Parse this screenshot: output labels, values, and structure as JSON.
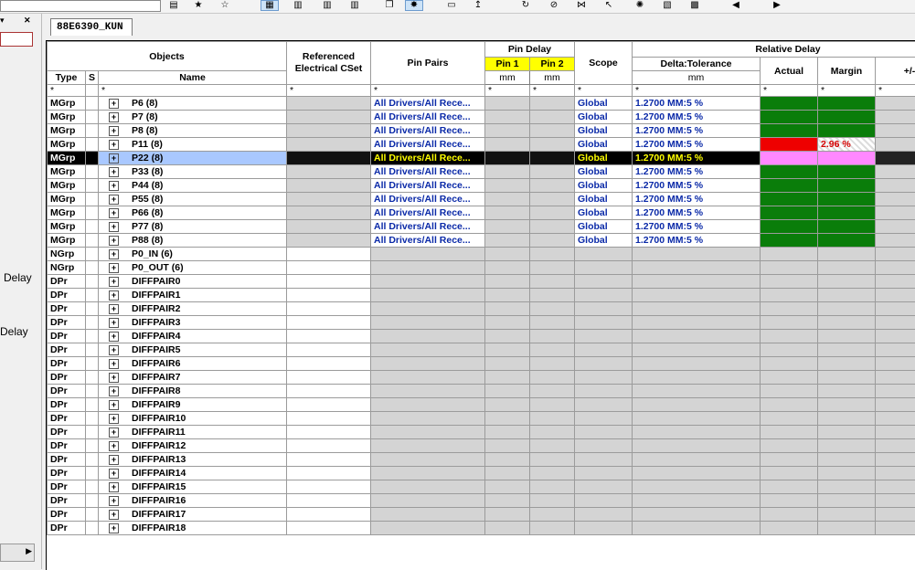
{
  "toolbar": {
    "icons": [
      "folder-icon",
      "star-icon",
      "star-icon",
      "grid-view-icon",
      "table-icon",
      "table-icon",
      "table-icon",
      "copy-icon",
      "burst-icon",
      "properties-icon",
      "pin-icon",
      "forward-icon",
      "cancel-icon",
      "bowtie-icon",
      "cursor-icon",
      "spark-icon",
      "chart-icon",
      "map-icon",
      "back-arrow-icon",
      "forward-arrow-icon"
    ]
  },
  "left_panel": {
    "label_delay_1": "Delay",
    "label_delay_2": "Delay"
  },
  "tab": {
    "label": "88E6390_KUN"
  },
  "grid": {
    "headers": {
      "objects": "Objects",
      "type": "Type",
      "s": "S",
      "name": "Name",
      "ref_cset": "Referenced Electrical CSet",
      "pin_pairs": "Pin Pairs",
      "pin_delay": "Pin Delay",
      "pin1": "Pin 1",
      "pin2": "Pin 2",
      "pin_unit": "mm",
      "scope": "Scope",
      "relative_delay": "Relative Delay",
      "delta_tol": "Delta:Tolerance",
      "delta_unit": "mm",
      "actual": "Actual",
      "margin": "Margin",
      "plusminus": "+/-"
    },
    "filter": "*",
    "rows": [
      {
        "type": "MGrp",
        "name": "P6 (8)",
        "pin_pairs": "All Drivers/All Rece...",
        "scope": "Global",
        "delta": "1.2700 MM:5 %",
        "actual": "green",
        "margin": "green",
        "margin_text": ""
      },
      {
        "type": "MGrp",
        "name": "P7 (8)",
        "pin_pairs": "All Drivers/All Rece...",
        "scope": "Global",
        "delta": "1.2700 MM:5 %",
        "actual": "green",
        "margin": "green",
        "margin_text": ""
      },
      {
        "type": "MGrp",
        "name": "P8 (8)",
        "pin_pairs": "All Drivers/All Rece...",
        "scope": "Global",
        "delta": "1.2700 MM:5 %",
        "actual": "green",
        "margin": "green",
        "margin_text": ""
      },
      {
        "type": "MGrp",
        "name": "P11 (8)",
        "pin_pairs": "All Drivers/All Rece...",
        "scope": "Global",
        "delta": "1.2700 MM:5 %",
        "actual": "red",
        "margin": "hatch",
        "margin_text": "2.96 %"
      },
      {
        "type": "MGrp",
        "name": "P22 (8)",
        "pin_pairs": "All Drivers/All Rece...",
        "scope": "Global",
        "delta": "1.2700 MM:5 %",
        "actual": "pink",
        "margin": "pink",
        "margin_text": "",
        "selected": true
      },
      {
        "type": "MGrp",
        "name": "P33 (8)",
        "pin_pairs": "All Drivers/All Rece...",
        "scope": "Global",
        "delta": "1.2700 MM:5 %",
        "actual": "green",
        "margin": "green",
        "margin_text": ""
      },
      {
        "type": "MGrp",
        "name": "P44 (8)",
        "pin_pairs": "All Drivers/All Rece...",
        "scope": "Global",
        "delta": "1.2700 MM:5 %",
        "actual": "green",
        "margin": "green",
        "margin_text": ""
      },
      {
        "type": "MGrp",
        "name": "P55 (8)",
        "pin_pairs": "All Drivers/All Rece...",
        "scope": "Global",
        "delta": "1.2700 MM:5 %",
        "actual": "green",
        "margin": "green",
        "margin_text": ""
      },
      {
        "type": "MGrp",
        "name": "P66 (8)",
        "pin_pairs": "All Drivers/All Rece...",
        "scope": "Global",
        "delta": "1.2700 MM:5 %",
        "actual": "green",
        "margin": "green",
        "margin_text": ""
      },
      {
        "type": "MGrp",
        "name": "P77 (8)",
        "pin_pairs": "All Drivers/All Rece...",
        "scope": "Global",
        "delta": "1.2700 MM:5 %",
        "actual": "green",
        "margin": "green",
        "margin_text": ""
      },
      {
        "type": "MGrp",
        "name": "P88 (8)",
        "pin_pairs": "All Drivers/All Rece...",
        "scope": "Global",
        "delta": "1.2700 MM:5 %",
        "actual": "green",
        "margin": "green",
        "margin_text": ""
      },
      {
        "type": "NGrp",
        "name": "P0_IN (6)"
      },
      {
        "type": "NGrp",
        "name": "P0_OUT (6)"
      },
      {
        "type": "DPr",
        "name": "DIFFPAIR0"
      },
      {
        "type": "DPr",
        "name": "DIFFPAIR1"
      },
      {
        "type": "DPr",
        "name": "DIFFPAIR2"
      },
      {
        "type": "DPr",
        "name": "DIFFPAIR3"
      },
      {
        "type": "DPr",
        "name": "DIFFPAIR4"
      },
      {
        "type": "DPr",
        "name": "DIFFPAIR5"
      },
      {
        "type": "DPr",
        "name": "DIFFPAIR6"
      },
      {
        "type": "DPr",
        "name": "DIFFPAIR7"
      },
      {
        "type": "DPr",
        "name": "DIFFPAIR8"
      },
      {
        "type": "DPr",
        "name": "DIFFPAIR9"
      },
      {
        "type": "DPr",
        "name": "DIFFPAIR10"
      },
      {
        "type": "DPr",
        "name": "DIFFPAIR11"
      },
      {
        "type": "DPr",
        "name": "DIFFPAIR12"
      },
      {
        "type": "DPr",
        "name": "DIFFPAIR13"
      },
      {
        "type": "DPr",
        "name": "DIFFPAIR14"
      },
      {
        "type": "DPr",
        "name": "DIFFPAIR15"
      },
      {
        "type": "DPr",
        "name": "DIFFPAIR16"
      },
      {
        "type": "DPr",
        "name": "DIFFPAIR17"
      },
      {
        "type": "DPr",
        "name": "DIFFPAIR18"
      }
    ]
  },
  "colors": {
    "pass": "#0a7d0a",
    "fail": "#ee0000",
    "selected_name": "#a9c8ff",
    "selected_highlight": "#ff88ff",
    "link_text": "#0b2aa8",
    "unit_highlight": "#ffff00"
  }
}
